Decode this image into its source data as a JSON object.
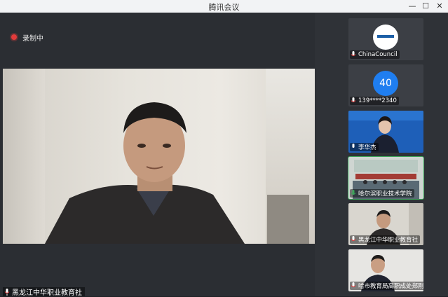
{
  "window": {
    "title": "腾讯会议"
  },
  "colors": {
    "recording": "#e23b3b",
    "active_border": "#3da55a",
    "avatar_blue": "#1f7ef0"
  },
  "main": {
    "recording_label": "录制中",
    "speaker_label": "黑龙江中华职业教育社"
  },
  "participants": [
    {
      "name": "ChinaCouncil",
      "type": "logo"
    },
    {
      "name": "139****2340",
      "type": "number",
      "avatar_text": "40"
    },
    {
      "name": "李华杰",
      "type": "video"
    },
    {
      "name": "哈尔滨职业技术学院",
      "type": "video",
      "active": true
    },
    {
      "name": "黑龙江中华职业教育社",
      "type": "video"
    },
    {
      "name": "哈市教育局高职成处郑刚",
      "type": "video"
    }
  ]
}
